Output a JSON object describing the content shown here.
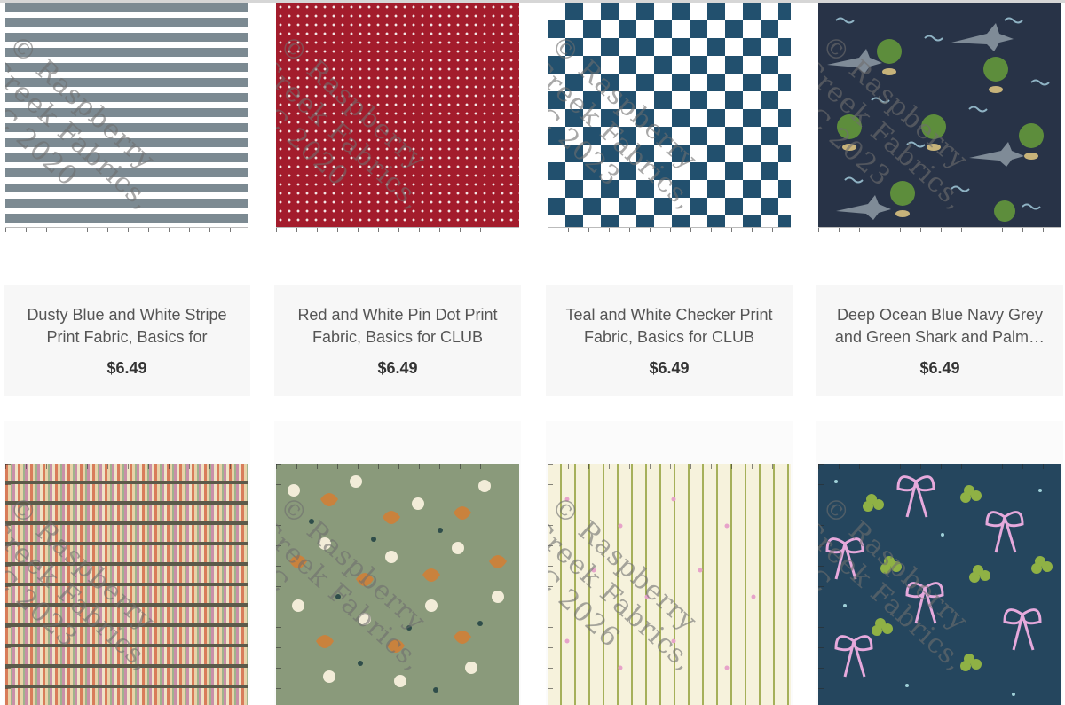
{
  "products": [
    {
      "title": "Dusty Blue and White Stripe Print Fabric, Basics for CLUB…",
      "price": "$6.49",
      "watermark": "© Raspberry Creek Fabrics, LLC 2020",
      "swatch_icon": "stripe-fabric-swatch"
    },
    {
      "title": "Red and White Pin Dot Print Fabric, Basics for CLUB Fabrics",
      "price": "$6.49",
      "watermark": "© Raspberry Creek Fabrics, LLC 2020",
      "swatch_icon": "pin-dot-fabric-swatch"
    },
    {
      "title": "Teal and White Checker Print Fabric, Basics for CLUB Fabrics",
      "price": "$6.49",
      "watermark": "© Raspberry Creek Fabrics, LLC 2023",
      "swatch_icon": "checker-fabric-swatch"
    },
    {
      "title": "Deep Ocean Blue Navy Grey and Green Shark and Palm…",
      "price": "$6.49",
      "watermark": "© Raspberry Creek Fabrics, LLC 2023",
      "swatch_icon": "shark-palm-fabric-swatch"
    },
    {
      "watermark": "© Raspberry Creek Fabrics, LLC 2023",
      "swatch_icon": "bookshelf-fabric-swatch"
    },
    {
      "watermark": "© Raspberry Creek Fabrics, LLC",
      "swatch_icon": "floral-fabric-swatch"
    },
    {
      "watermark": "© Raspberry Creek Fabrics, LLC 2026",
      "swatch_icon": "pinstripe-fabric-swatch"
    },
    {
      "watermark": "© Raspberry Creek Fabrics, LLC",
      "swatch_icon": "bow-clover-fabric-swatch"
    }
  ]
}
